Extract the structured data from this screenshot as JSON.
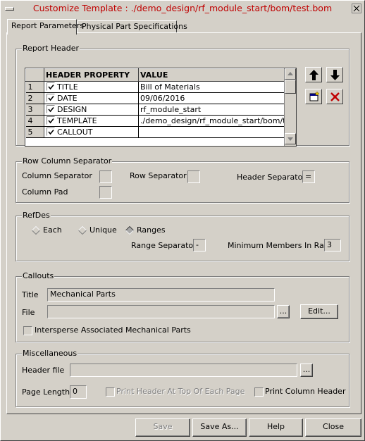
{
  "window": {
    "title": "Customize Template : ./demo_design/rf_module_start/bom/test.bom"
  },
  "tabs": [
    {
      "label": "Report Parameters",
      "active": true
    },
    {
      "label": "Physical Part Specifications",
      "active": false
    }
  ],
  "report_header": {
    "group_title": "Report Header",
    "columns": {
      "property": "HEADER PROPERTY",
      "value": "VALUE"
    },
    "rows": [
      {
        "num": "1",
        "property": "TITLE",
        "value": "Bill of Materials",
        "checked": true
      },
      {
        "num": "2",
        "property": "DATE",
        "value": "09/06/2016",
        "checked": true
      },
      {
        "num": "3",
        "property": "DESIGN",
        "value": "rf_module_start",
        "checked": true
      },
      {
        "num": "4",
        "property": "TEMPLATE",
        "value": "./demo_design/rf_module_start/bom/t",
        "checked": true
      },
      {
        "num": "5",
        "property": "CALLOUT",
        "value": "",
        "checked": true
      }
    ],
    "tool_icons": [
      "move-up-arrow-icon",
      "move-down-arrow-icon",
      "new-row-icon",
      "delete-row-icon"
    ]
  },
  "row_column_separator": {
    "group_title": "Row Column Separator",
    "column_separator_label": "Column Separator",
    "column_separator_value": "",
    "row_separator_label": "Row Separator",
    "row_separator_value": "",
    "header_separator_label": "Header Separator",
    "header_separator_value": "=",
    "column_pad_label": "Column Pad",
    "column_pad_value": ""
  },
  "refdes": {
    "group_title": "RefDes",
    "options": [
      {
        "label": "Each",
        "selected": false
      },
      {
        "label": "Unique",
        "selected": false
      },
      {
        "label": "Ranges",
        "selected": true
      }
    ],
    "range_separator_label": "Range Separator",
    "range_separator_value": "-",
    "min_members_label": "Minimum Members In Range",
    "min_members_value": "3"
  },
  "callouts": {
    "group_title": "Callouts",
    "title_label": "Title",
    "title_value": "Mechanical Parts",
    "file_label": "File",
    "file_value": "",
    "browse_label": "...",
    "edit_label": "Edit...",
    "intersperse_label": "Intersperse Associated Mechanical Parts",
    "intersperse_checked": false
  },
  "misc": {
    "group_title": "Miscellaneous",
    "header_file_label": "Header file",
    "header_file_value": "",
    "browse_label": "...",
    "page_length_label": "Page Length",
    "page_length_value": "0",
    "print_header_top_label": "Print Header At Top Of Each Page",
    "print_header_top_checked": false,
    "print_column_header_label": "Print Column Header",
    "print_column_header_checked": false
  },
  "footer": {
    "save_label": "Save",
    "save_as_label": "Save As...",
    "help_label": "Help",
    "close_label": "Close"
  },
  "colors": {
    "title_text": "#c00000",
    "face": "#d4d0c8",
    "delete_icon": "#c00000"
  }
}
